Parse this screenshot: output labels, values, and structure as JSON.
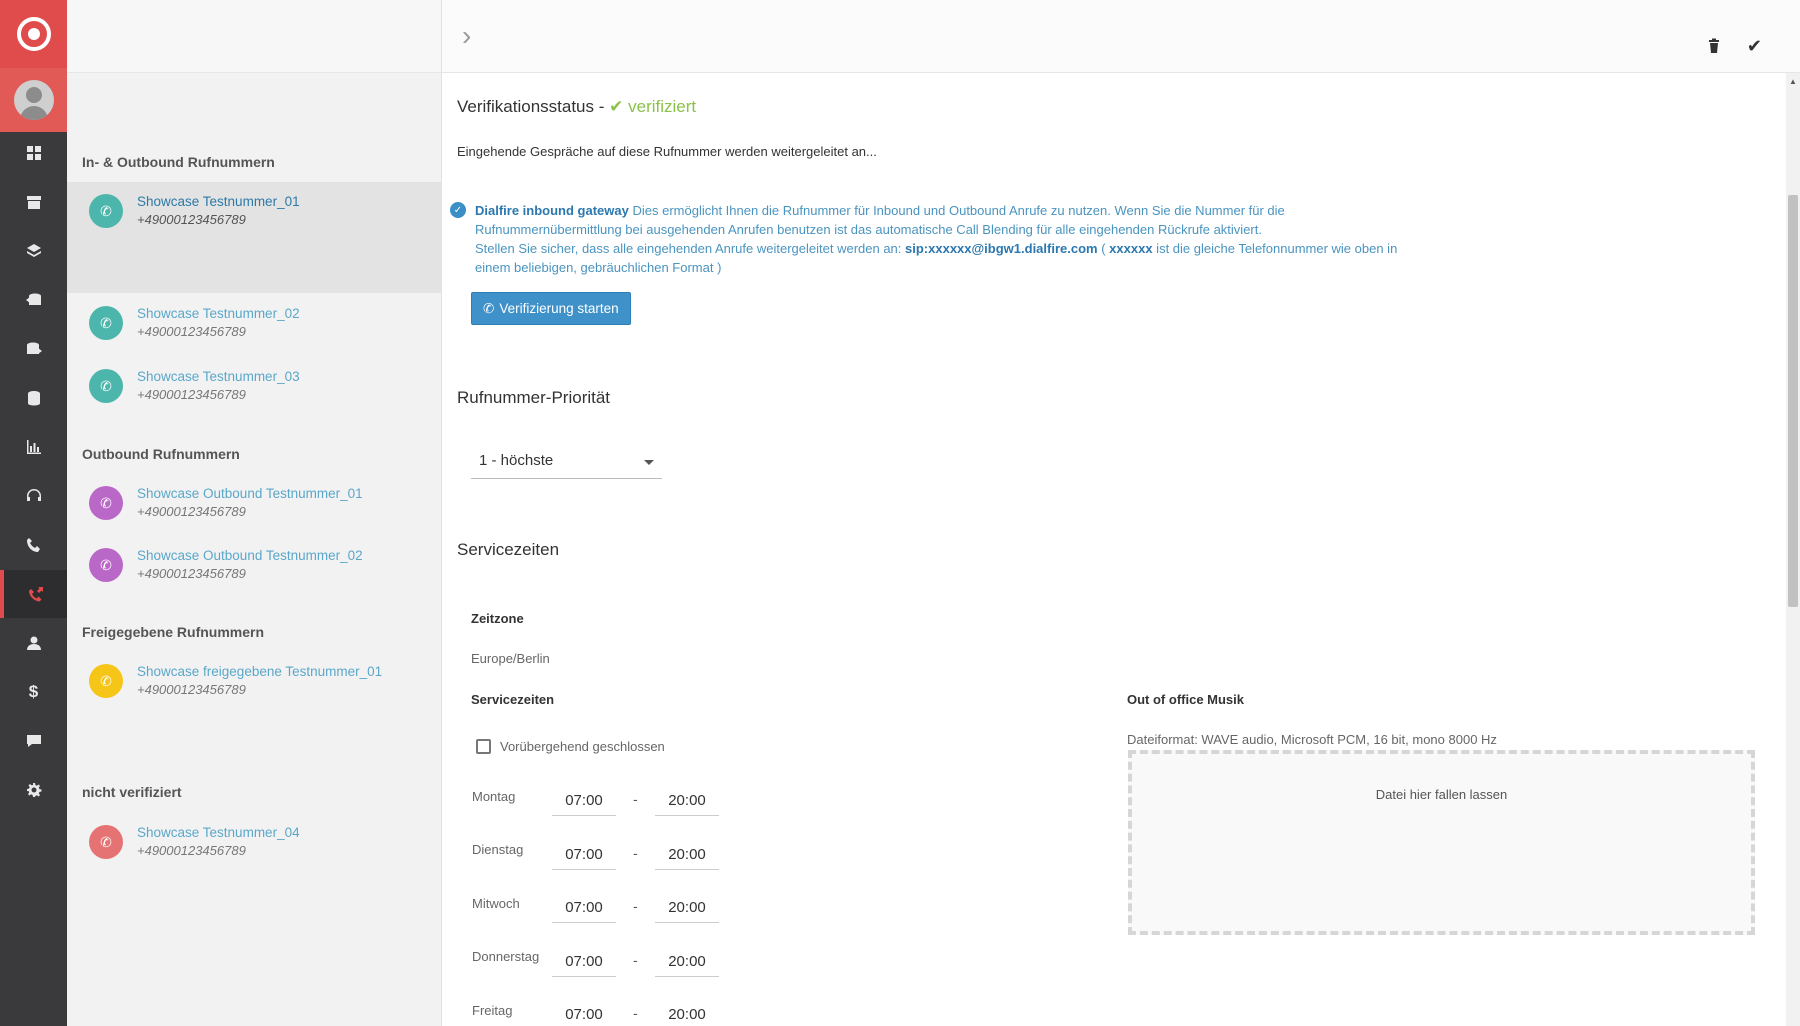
{
  "rail": {
    "items": [
      {
        "icon": "dashboard-icon",
        "top": 0
      },
      {
        "icon": "archive-icon"
      },
      {
        "icon": "layers-icon"
      },
      {
        "icon": "database-import-icon"
      },
      {
        "icon": "database-export-icon"
      },
      {
        "icon": "database-icon"
      },
      {
        "icon": "bar-chart-icon"
      },
      {
        "icon": "headset-icon"
      },
      {
        "icon": "phone-icon"
      },
      {
        "icon": "phone-forward-icon",
        "active": true
      },
      {
        "icon": "user-icon"
      },
      {
        "icon": "dollar-icon"
      },
      {
        "icon": "chat-icon"
      },
      {
        "icon": "gear-icon"
      }
    ],
    "accent": "#e04b4b"
  },
  "list": {
    "groups": [
      {
        "title": "In- & Outbound Rufnummern"
      },
      {
        "title": "Outbound Rufnummern"
      },
      {
        "title": "Freigegebene Rufnummern"
      },
      {
        "title": "nicht verifiziert"
      }
    ],
    "entries": [
      {
        "name": "Showcase Testnummer_01",
        "number": "+49000123456789",
        "color": "#4db6ac"
      },
      {
        "name": "Showcase Testnummer_02",
        "number": "+49000123456789",
        "color": "#4db6ac"
      },
      {
        "name": "Showcase Testnummer_03",
        "number": "+49000123456789",
        "color": "#4db6ac"
      },
      {
        "name": "Showcase Outbound Testnummer_01",
        "number": "+49000123456789",
        "color": "#ba68c8"
      },
      {
        "name": "Showcase Outbound Testnummer_02",
        "number": "+49000123456789",
        "color": "#ba68c8"
      },
      {
        "name": "Showcase freigegebene Testnummer_01",
        "number": "+49000123456789",
        "color": "#f5c518"
      },
      {
        "name": "Showcase Testnummer_04",
        "number": "+49000123456789",
        "color": "#e57373"
      }
    ]
  },
  "main": {
    "verification_title": "Verifikationsstatus -",
    "verification_status": "verifiziert",
    "forward_text": "Eingehende Gespräche auf diese Rufnummer werden weitergeleitet an...",
    "info": {
      "gateway": "Dialfire inbound gateway",
      "text1": " Dies ermöglicht Ihnen die Rufnummer für Inbound und Outbound Anrufe zu nutzen. Wenn Sie die Nummer für die Rufnummernübermittlung bei ausgehenden Anrufen benutzen ist das automatische Call Blending für alle eingehenden Rückrufe aktiviert.",
      "text2": "Stellen Sie sicher, dass alle eingehenden Anrufe weitergeleitet werden an: ",
      "sip": "sip:xxxxxx@ibgw1.dialfire.com",
      "text3": " ( ",
      "placeholder": "xxxxxx",
      "text4": " ist die gleiche Telefonnummer wie oben in einem beliebigen, gebräuchlichen Format )"
    },
    "verify_button": "Verifizierung starten",
    "priority_title": "Rufnummer-Priorität",
    "priority_value": "1 - höchste",
    "service_title": "Servicezeiten",
    "timezone_label": "Zeitzone",
    "timezone_value": "Europe/Berlin",
    "service_label": "Servicezeiten",
    "closed_label": "Vorübergehend geschlossen",
    "days": [
      {
        "name": "Montag",
        "from": "07:00",
        "to": "20:00"
      },
      {
        "name": "Dienstag",
        "from": "07:00",
        "to": "20:00"
      },
      {
        "name": "Mitwoch",
        "from": "07:00",
        "to": "20:00"
      },
      {
        "name": "Donnerstag",
        "from": "07:00",
        "to": "20:00"
      },
      {
        "name": "Freitag",
        "from": "07:00",
        "to": "20:00"
      }
    ],
    "dash": "-",
    "music_label": "Out of office Musik",
    "file_format": "Dateiformat: WAVE audio, Microsoft PCM, 16 bit, mono 8000 Hz",
    "drop_text": "Datei hier fallen lassen"
  }
}
